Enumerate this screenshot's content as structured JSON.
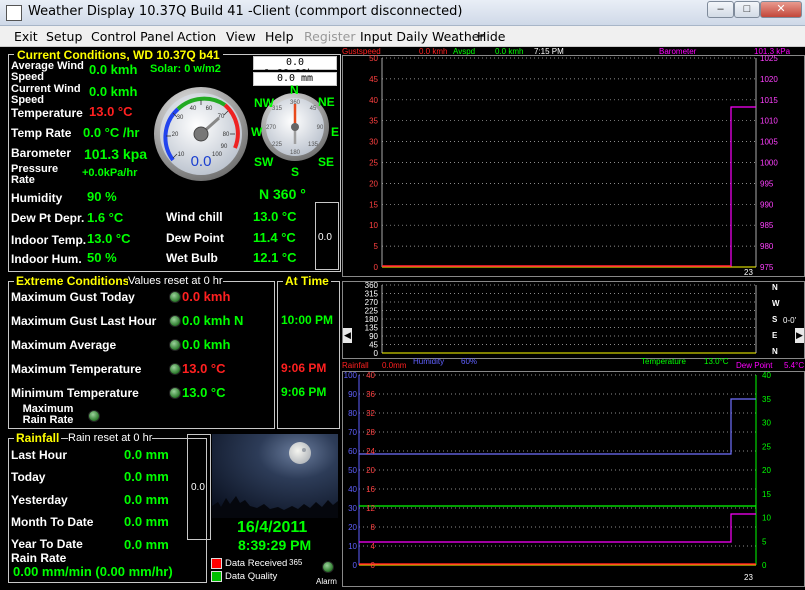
{
  "window": {
    "title": "Weather Display  10.37Q Build 41 -Client (commport disconnected)"
  },
  "menu": [
    "Exit",
    "Setup",
    "Control Panel",
    "Action",
    "View",
    "Help",
    "Register",
    "Input Daily Weather",
    "Hide"
  ],
  "current": {
    "header": "Current Conditions, WD 10.37Q b41",
    "avg_wind_label": "Average Wind Speed",
    "avg_wind": "0.0 kmh",
    "solar": "Solar: 0 w/m2",
    "cur_wind_label": "Current Wind Speed",
    "cur_wind": "0.0 kmh",
    "temp_label": "Temperature",
    "temp": "13.0 °C",
    "temprate_label": "Temp Rate",
    "temprate": "0.0 °C /hr",
    "baro_label": "Barometer",
    "baro": "101.3 kpa",
    "pressrate_label": "Pressure Rate",
    "pressrate": "+0.0kPa/hr",
    "humidity_label": "Humidity",
    "humidity": "90 %",
    "dewdepr_label": "Dew Pt Depr.",
    "dewdepr": "1.6 °C",
    "windchill_label": "Wind chill",
    "windchill": "13.0 °C",
    "indoortemp_label": "Indoor Temp.",
    "indoortemp": "13.0 °C",
    "dewpoint_label": "Dew Point",
    "dewpoint": "11.4 °C",
    "indoorhum_label": "Indoor Hum.",
    "indoorhum": "50 %",
    "wetbulb_label": "Wet Bulb",
    "wetbulb": "12.1 °C",
    "rain_hrs": "0.0 %,00:00hrs",
    "rain_mm": "0.0 mm",
    "wind_dir": "N  360 °",
    "side_value": "0.0",
    "gauge_value": "0.0"
  },
  "compass": {
    "N": "N",
    "NE": "NE",
    "E": "E",
    "SE": "SE",
    "S": "S",
    "SW": "SW",
    "W": "W",
    "NW": "NW"
  },
  "extreme": {
    "header": "Extreme Conditions",
    "reset": "Values reset at 0 hr",
    "attime": "At Time",
    "max_gust_today_label": "Maximum Gust Today",
    "max_gust_today": "0.0 kmh",
    "max_gust_hour_label": "Maximum Gust Last Hour",
    "max_gust_hour": "0.0 kmh  N",
    "max_gust_hour_time": "10:00 PM",
    "max_avg_label": "Maximum Average",
    "max_avg": "0.0 kmh",
    "max_temp_label": "Maximum Temperature",
    "max_temp": "13.0 °C",
    "max_temp_time": "9:06 PM",
    "min_temp_label": "Minimum Temperature",
    "min_temp": "13.0 °C",
    "min_temp_time": "9:06 PM",
    "max_rainrate_label": "Maximum Rain Rate"
  },
  "rainfall": {
    "header": "Rainfall",
    "reset": "Rain reset at 0 hr",
    "last_hour_label": "Last Hour",
    "last_hour": "0.0 mm",
    "today_label": "Today",
    "today": "0.0 mm",
    "yesterday_label": "Yesterday",
    "yesterday": "0.0 mm",
    "month_label": "Month To Date",
    "month": "0.0 mm",
    "year_label": "Year To Date",
    "year": "0.0 mm",
    "rate_label": "Rain Rate",
    "rate": "0.00 mm/min (0.00 mm/hr)"
  },
  "status": {
    "side_value": "0.0",
    "date": "16/4/2011",
    "time": "8:39:29 PM",
    "count": "365",
    "data_received": "Data Received",
    "data_quality": "Data Quality",
    "alarm": "Alarm",
    "colors": {
      "received": "#ff0000",
      "quality": "#00c000"
    }
  },
  "graphs": {
    "top": {
      "legend": {
        "gust": "Gustspeed",
        "gust_val": "0.0 kmh",
        "avg": "Avspd",
        "avg_val": "0.0 kmh",
        "time": "7:15 PM",
        "baro": "Barometer",
        "baro_val": "101.3 kPa"
      },
      "left_ticks": [
        "50",
        "45",
        "40",
        "35",
        "30",
        "25",
        "20",
        "15",
        "10",
        "5",
        "0"
      ],
      "right_ticks": [
        "1025",
        "1020",
        "1015",
        "1010",
        "1005",
        "1000",
        "995",
        "990",
        "985",
        "980",
        "975"
      ],
      "x_label": "23"
    },
    "mid": {
      "left_ticks": [
        "360",
        "315",
        "270",
        "225",
        "180",
        "135",
        "90",
        "45",
        "0"
      ],
      "right_letters": [
        "N",
        "W",
        "S",
        "E",
        "N"
      ],
      "side_value": "0-0'",
      "x_label": ""
    },
    "bottom": {
      "legend": {
        "rain": "Rainfall",
        "rain_val": "0.0mm",
        "hum": "Humidity",
        "hum_val": "60%",
        "temp": "Temperature",
        "temp_val": "13.0°C",
        "dew": "Dew Point",
        "dew_val": "5.4°C"
      },
      "left_ticks": [
        "100",
        "90",
        "80",
        "70",
        "60",
        "50",
        "40",
        "30",
        "20",
        "10",
        "0"
      ],
      "inner_ticks": [
        "40",
        "36",
        "32",
        "28",
        "24",
        "20",
        "16",
        "12",
        "8",
        "4",
        "0"
      ],
      "right_ticks": [
        "40",
        "35",
        "30",
        "25",
        "20",
        "15",
        "10",
        "5",
        "0"
      ],
      "x_label": "23"
    }
  }
}
